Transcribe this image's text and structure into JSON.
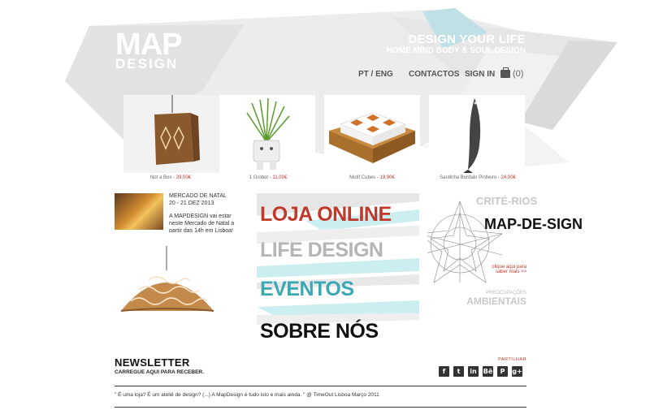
{
  "header": {
    "logo_top": "MAP",
    "logo_bottom": "DESIGN",
    "tagline_main": "DESIGN YOUR LIFE",
    "tagline_sub": "HOME MIND BODY & SOUL DESIGN"
  },
  "nav": {
    "lang": "PT / ENG",
    "contact": "CONTACTOS",
    "signin": "SIGN IN",
    "cart_count": "(0)"
  },
  "products": [
    {
      "name": "Not a Box - ",
      "price": "39,00€"
    },
    {
      "name": "1 Grobot - ",
      "price": "11,00€"
    },
    {
      "name": "Motif Cubes - ",
      "price": "19,90€"
    },
    {
      "name": "Sardinha Bordalo Pinheiro - ",
      "price": "24,00€"
    }
  ],
  "news": {
    "title": "MERCADO DE NATAL",
    "date": "20 - 21 DEZ 2013",
    "body": "A MAPDESIGN vai estar neste Mercado de Natal a partir das 14h em Lisboa!"
  },
  "menu": {
    "loja": "LOJA ONLINE",
    "life": "LIFE DESIGN",
    "eventos": "EVENTOS",
    "sobre": "SOBRE NÓS"
  },
  "criterios": {
    "line1": "CRITÉ-RIOS",
    "line2": "MAP-DE-SIGN",
    "click": "clique aqui para saber mais >>",
    "preocup": "PREOCUPAÇÕES",
    "ambientais": "AMBIENTAIS"
  },
  "newsletter": {
    "title": "NEWSLETTER",
    "subtitle": "CARREGUE AQUI PARA RECEBER."
  },
  "share": {
    "label": "PARTILHAR",
    "icons": [
      "f",
      "t",
      "in",
      "Bē",
      "P",
      "g+"
    ]
  },
  "footer": {
    "quote": "\" É uma loja? É um ateliê de design? (...) A MapDesign é tudo isto e mais ainda. \"  @ TimeOut Lisboa Março 2011"
  },
  "colors": {
    "accent_red": "#c0392b",
    "accent_teal": "#3aa9b3",
    "grey": "#b5b5b5"
  }
}
